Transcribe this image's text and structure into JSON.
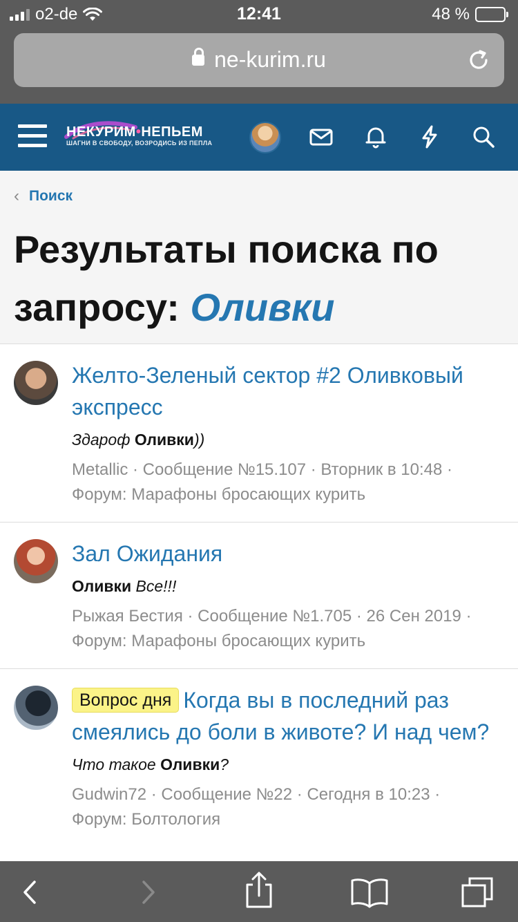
{
  "status_bar": {
    "carrier": "o2-de",
    "time": "12:41",
    "battery": "48 %"
  },
  "browser": {
    "url": "ne-kurim.ru"
  },
  "site": {
    "logo_title_1": "НЕКУРИМ",
    "logo_dot": "•",
    "logo_title_2": "НЕПЬЕМ",
    "logo_tagline": "ШАГНИ В СВОБОДУ, ВОЗРОДИСЬ ИЗ ПЕПЛА"
  },
  "breadcrumb": {
    "label": "Поиск"
  },
  "page": {
    "title_prefix": "Результаты поиска по запросу: ",
    "query": "Оливки"
  },
  "results": [
    {
      "title": "Желто-Зеленый сектор #2 Оливковый экспресс",
      "snippet_pre": "Здароф ",
      "snippet_bold": "Оливки",
      "snippet_post": "))",
      "meta_line_1": "Metallic · Сообщение №15.107 · Вторник в 10:48 ·",
      "meta_line_2": "Форум: Марафоны бросающих курить"
    },
    {
      "title": "Зал Ожидания",
      "snippet_pre": "",
      "snippet_bold": "Оливки",
      "snippet_post": " Все!!!",
      "meta_line_1": "Рыжая Бестия · Сообщение №1.705 · 26 Сен 2019 ·",
      "meta_line_2": "Форум: Марафоны бросающих курить"
    },
    {
      "prefix": "Вопрос дня",
      "title": "Когда вы в последний раз смеялись до боли в животе? И над чем?",
      "snippet_pre": "Что такое ",
      "snippet_bold": "Оливки",
      "snippet_post": "?",
      "meta_line_1": "Gudwin72 · Сообщение №22 · Сегодня в 10:23 ·",
      "meta_line_2": "Форум: Болтология"
    }
  ],
  "colors": {
    "header_bg": "#185886",
    "link": "#2577b1",
    "chrome": "#5b5b5b",
    "prefix_badge": "#fbf388"
  },
  "icons": [
    "menu-icon",
    "mail-icon",
    "bell-icon",
    "bolt-icon",
    "search-icon",
    "lock-icon",
    "reload-icon",
    "back-icon",
    "forward-icon",
    "share-icon",
    "bookmarks-icon",
    "tabs-icon"
  ]
}
